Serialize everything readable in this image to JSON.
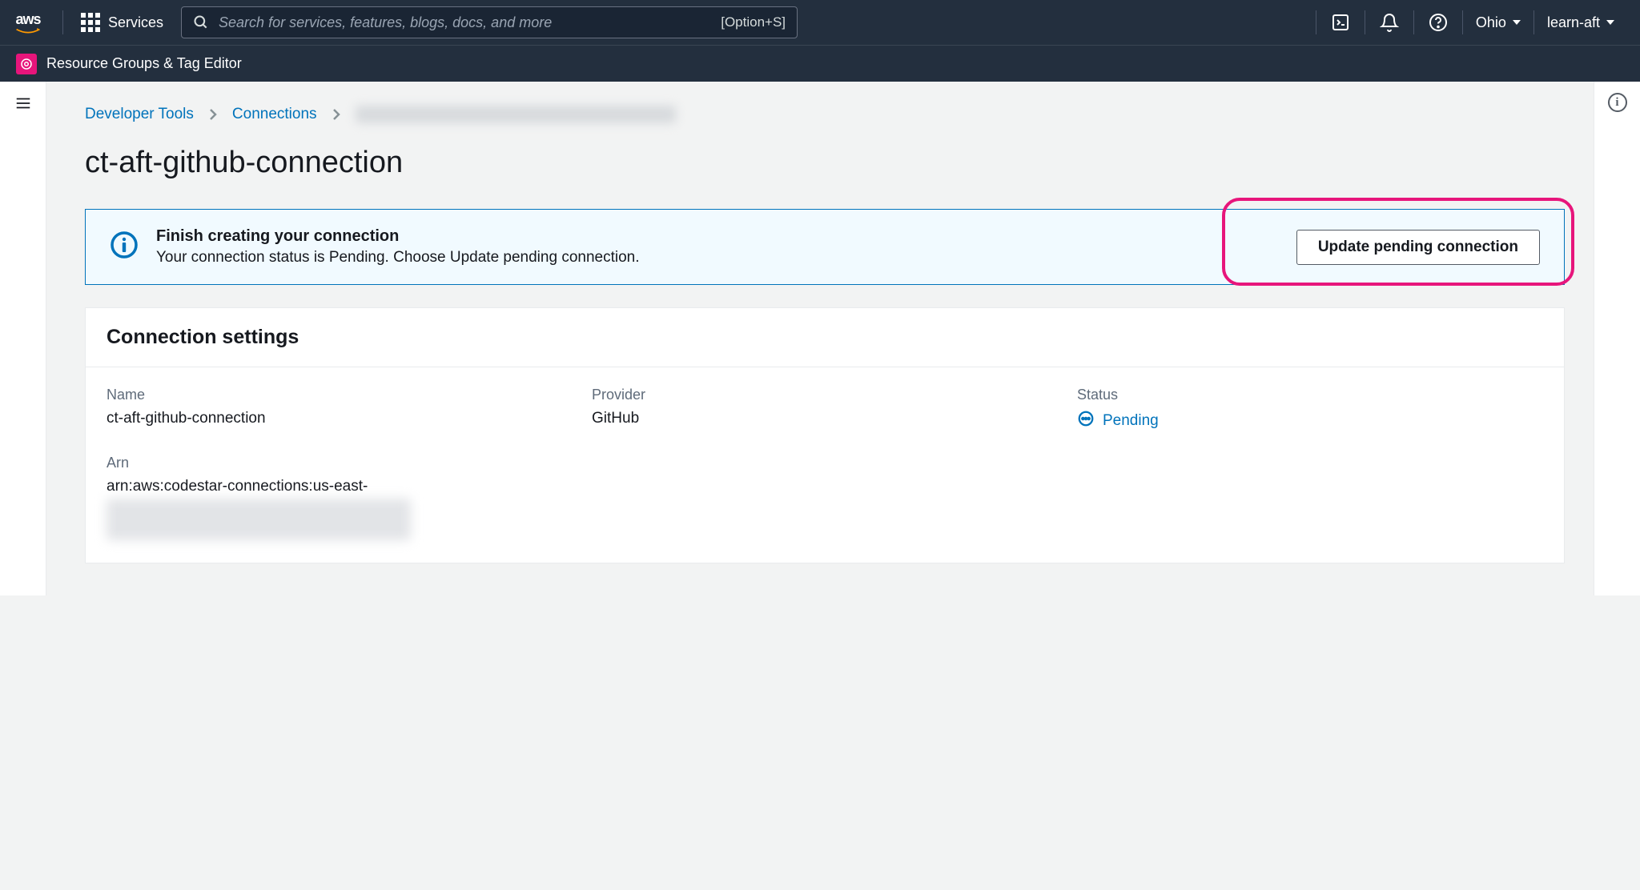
{
  "topnav": {
    "services_label": "Services",
    "search_placeholder": "Search for services, features, blogs, docs, and more",
    "search_shortcut": "[Option+S]",
    "region": "Ohio",
    "account": "learn-aft"
  },
  "secondnav": {
    "resource_groups_label": "Resource Groups & Tag Editor"
  },
  "breadcrumb": {
    "item1": "Developer Tools",
    "item2": "Connections"
  },
  "page": {
    "title": "ct-aft-github-connection"
  },
  "alert": {
    "title": "Finish creating your connection",
    "text": "Your connection status is Pending. Choose Update pending connection.",
    "button": "Update pending connection"
  },
  "settings": {
    "card_title": "Connection settings",
    "name_label": "Name",
    "name_value": "ct-aft-github-connection",
    "provider_label": "Provider",
    "provider_value": "GitHub",
    "status_label": "Status",
    "status_value": "Pending",
    "arn_label": "Arn",
    "arn_value": "arn:aws:codestar-connections:us-east-"
  }
}
